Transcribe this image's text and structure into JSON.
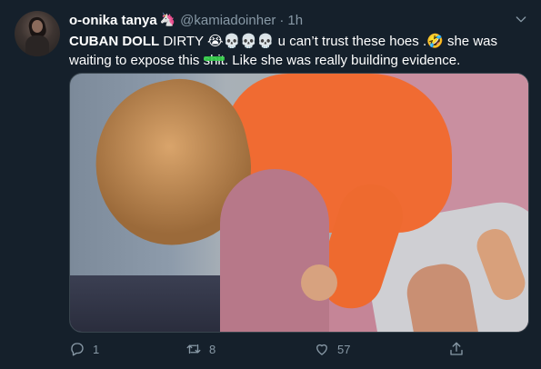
{
  "tweet": {
    "author": {
      "display_name": "o-onika tanya",
      "name_emoji": "🦄",
      "handle": "@kamiadoinher",
      "separator": "·",
      "time": "1h"
    },
    "text": {
      "bold_prefix": "CUBAN DOLL",
      "line1_a": " DIRTY ",
      "emoji_cry": "😭",
      "emoji_skulls": "💀💀💀",
      "line1_b": " u can’t trust these hoes .",
      "emoji_laugh": "🤣",
      "line1_c": " she was",
      "line2_a": "waiting to expose this ",
      "censored_word": "shit",
      "line2_b": ". Like she was really building evidence."
    },
    "actions": {
      "reply_count": "1",
      "retweet_count": "8",
      "like_count": "57"
    },
    "icons": {
      "menu": "chevron-down-icon",
      "reply": "reply-icon",
      "retweet": "retweet-icon",
      "like": "heart-icon",
      "share": "share-icon"
    },
    "colors": {
      "background": "#15202b",
      "secondary_text": "#8899a6",
      "censor_mark": "#35d04a"
    }
  }
}
